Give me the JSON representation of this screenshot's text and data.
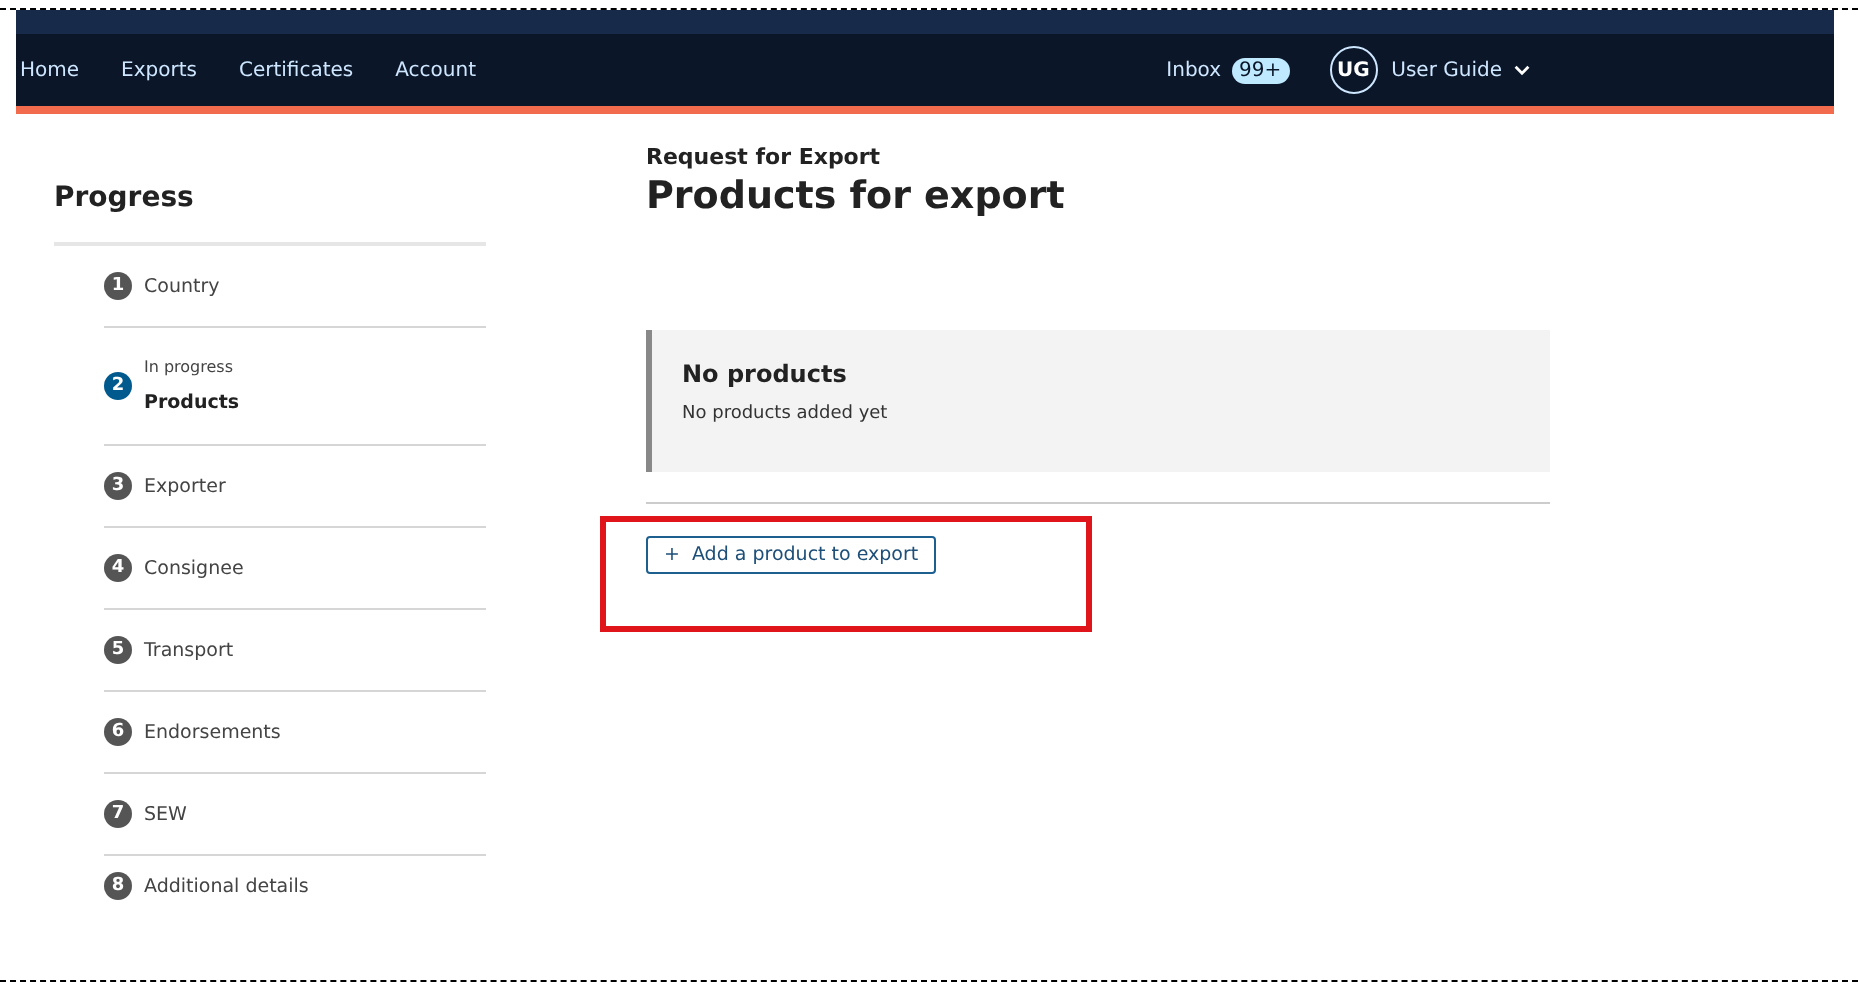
{
  "nav": {
    "links": [
      {
        "label": "Home"
      },
      {
        "label": "Exports"
      },
      {
        "label": "Certificates"
      },
      {
        "label": "Account"
      }
    ],
    "inbox": {
      "label": "Inbox",
      "count": "99+"
    },
    "user": {
      "initials": "UG",
      "name": "User Guide"
    }
  },
  "sidebar": {
    "title": "Progress",
    "steps": [
      {
        "number": "1",
        "label": "Country",
        "selected": false
      },
      {
        "number": "2",
        "label": "Products",
        "status": "In progress",
        "selected": true
      },
      {
        "number": "3",
        "label": "Exporter",
        "selected": false
      },
      {
        "number": "4",
        "label": "Consignee",
        "selected": false
      },
      {
        "number": "5",
        "label": "Transport",
        "selected": false
      },
      {
        "number": "6",
        "label": "Endorsements",
        "selected": false
      },
      {
        "number": "7",
        "label": "SEW",
        "selected": false
      },
      {
        "number": "8",
        "label": "Additional details",
        "selected": false
      }
    ]
  },
  "main": {
    "caption": "Request for Export",
    "title": "Products for export",
    "notice": {
      "title": "No products",
      "text": "No products added yet"
    },
    "add_button": {
      "icon": "+",
      "label": "Add a product to export"
    }
  }
}
